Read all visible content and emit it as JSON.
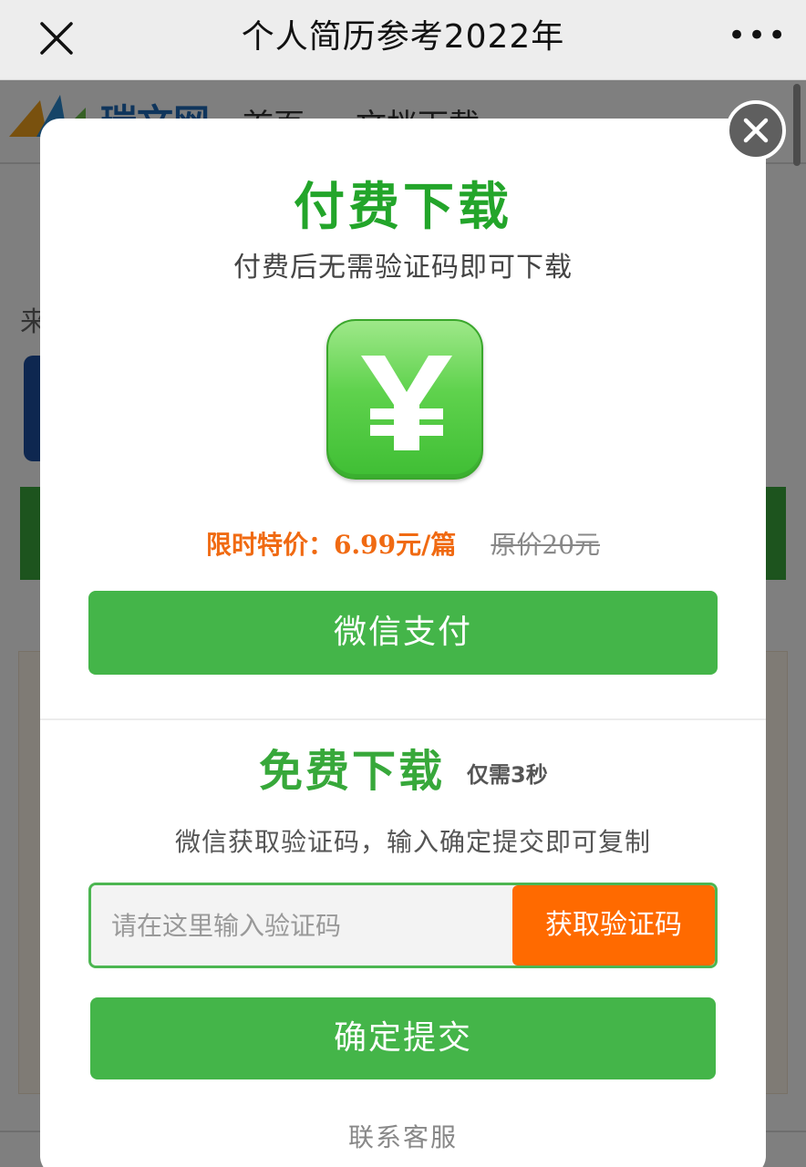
{
  "titlebar": {
    "title": "个人简历参考2022年",
    "more_label": "•••"
  },
  "background_page": {
    "logo_text": "瑞文网",
    "nav": [
      "首页",
      "文档下载"
    ],
    "partial_text": "来"
  },
  "modal": {
    "paid": {
      "title": "付费下载",
      "subtitle": "付费后无需验证码即可下载",
      "icon": "yen-icon",
      "price_label": "限时特价：6.99元/篇",
      "original_price": "原价20元",
      "pay_button": "微信支付"
    },
    "free": {
      "title": "免费下载",
      "tag": "仅需3秒",
      "subtitle": "微信获取验证码，输入确定提交即可复制",
      "code_placeholder": "请在这里输入验证码",
      "get_code_button": "获取验证码",
      "submit_button": "确定提交",
      "service_link": "联系客服"
    }
  },
  "colors": {
    "accent_green": "#44b549",
    "title_green": "#23a52a",
    "price_orange": "#f06a12",
    "code_button_orange": "#ff6a00"
  }
}
